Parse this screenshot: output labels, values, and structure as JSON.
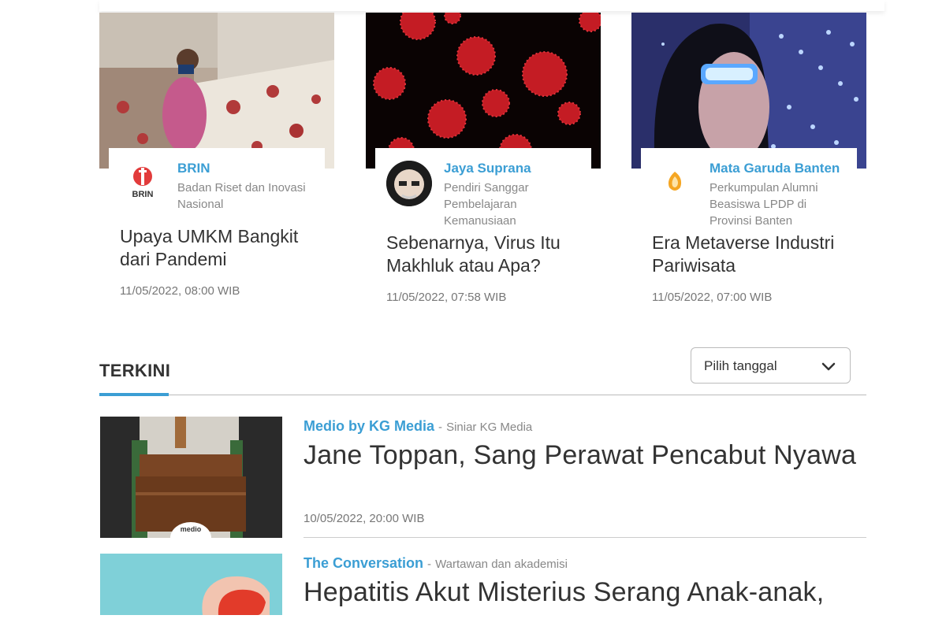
{
  "featured": [
    {
      "author_name": "BRIN",
      "author_desc": "Badan Riset dan Inovasi Nasional",
      "title": "Upaya UMKM Bangkit dari Pandemi",
      "date": "11/05/2022, 08:00 WIB",
      "logo_text": "BRIN"
    },
    {
      "author_name": "Jaya Suprana",
      "author_desc": "Pendiri Sanggar Pembelajaran Kemanusiaan",
      "title": "Sebenarnya, Virus Itu Makhluk atau Apa?",
      "date": "11/05/2022, 07:58 WIB"
    },
    {
      "author_name": "Mata Garuda Banten",
      "author_desc": "Perkumpulan Alumni Beasiswa LPDP di Provinsi Banten",
      "title": "Era Metaverse Industri Pariwisata",
      "date": "11/05/2022, 07:00 WIB"
    }
  ],
  "section": {
    "title": "TERKINI",
    "date_picker_label": "Pilih tanggal"
  },
  "latest": [
    {
      "source": "Medio by KG Media",
      "separator": "-",
      "source_desc": "Siniar KG Media",
      "headline": "Jane Toppan, Sang Perawat Pencabut Nyawa",
      "date": "10/05/2022, 20:00 WIB",
      "badge": "medio"
    },
    {
      "source": "The Conversation",
      "separator": "-",
      "source_desc": "Wartawan dan akademisi",
      "headline": "Hepatitis Akut Misterius Serang Anak-anak,"
    }
  ],
  "colors": {
    "accent": "#3b9ed4",
    "text": "#333333",
    "muted": "#888888"
  }
}
